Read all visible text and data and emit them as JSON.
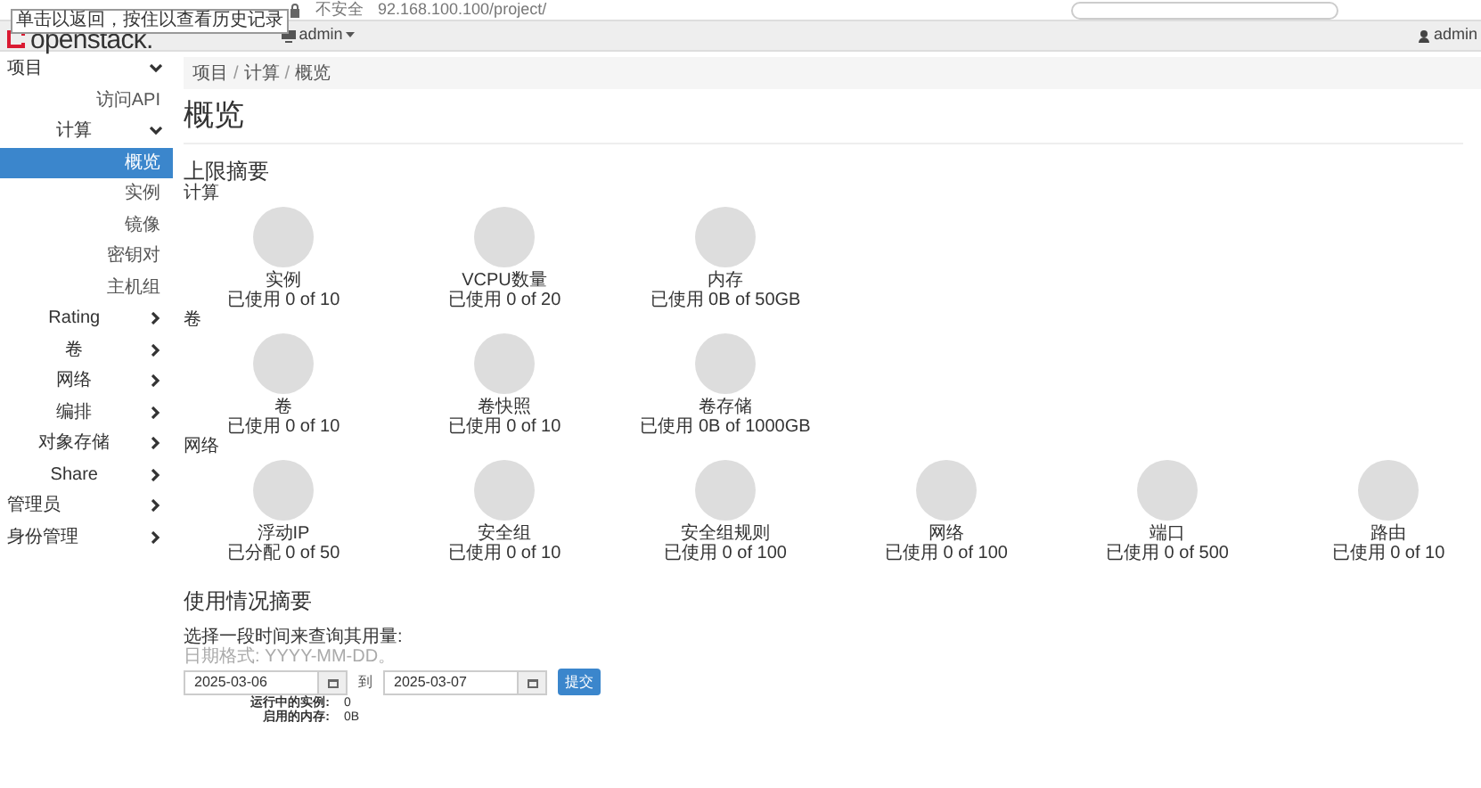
{
  "browser": {
    "security": "不安全",
    "url": "92.168.100.100/project/",
    "tooltip": "单击以返回，按住以查看历史记录"
  },
  "header": {
    "logo": "openstack.",
    "project_menu": "admin",
    "user": "admin"
  },
  "sidebar": {
    "items": [
      {
        "label": "项目",
        "kind": "group",
        "expanded": true,
        "children": [
          {
            "label": "访问API",
            "kind": "link",
            "selected": false
          },
          {
            "label": "计算",
            "kind": "group",
            "expanded": true,
            "children": [
              {
                "label": "概览",
                "kind": "link",
                "selected": true
              },
              {
                "label": "实例",
                "kind": "link",
                "selected": false
              },
              {
                "label": "镜像",
                "kind": "link",
                "selected": false
              },
              {
                "label": "密钥对",
                "kind": "link",
                "selected": false
              },
              {
                "label": "主机组",
                "kind": "link",
                "selected": false
              }
            ]
          },
          {
            "label": "Rating",
            "kind": "group",
            "expanded": false
          },
          {
            "label": "卷",
            "kind": "group",
            "expanded": false
          },
          {
            "label": "网络",
            "kind": "group",
            "expanded": false
          },
          {
            "label": "编排",
            "kind": "group",
            "expanded": false
          },
          {
            "label": "对象存储",
            "kind": "group",
            "expanded": false
          },
          {
            "label": "Share",
            "kind": "group",
            "expanded": false
          }
        ]
      },
      {
        "label": "管理员",
        "kind": "group",
        "expanded": false
      },
      {
        "label": "身份管理",
        "kind": "group",
        "expanded": false
      }
    ]
  },
  "breadcrumb": {
    "items": [
      "项目",
      "计算",
      "概览"
    ],
    "separator": "/"
  },
  "title": "概览",
  "limits": {
    "heading": "上限摘要",
    "groups": [
      {
        "title": "计算",
        "items": [
          {
            "label": "实例",
            "usage": "已使用 0 of 10"
          },
          {
            "label": "VCPU数量",
            "usage": "已使用 0 of 20"
          },
          {
            "label": "内存",
            "usage": "已使用 0B of 50GB"
          }
        ]
      },
      {
        "title": "卷",
        "items": [
          {
            "label": "卷",
            "usage": "已使用 0 of 10"
          },
          {
            "label": "卷快照",
            "usage": "已使用 0 of 10"
          },
          {
            "label": "卷存储",
            "usage": "已使用 0B of 1000GB"
          }
        ]
      },
      {
        "title": "网络",
        "items": [
          {
            "label": "浮动IP",
            "usage": "已分配 0 of 50"
          },
          {
            "label": "安全组",
            "usage": "已使用 0 of 10"
          },
          {
            "label": "安全组规则",
            "usage": "已使用 0 of 100"
          },
          {
            "label": "网络",
            "usage": "已使用 0 of 100"
          },
          {
            "label": "端口",
            "usage": "已使用 0 of 500"
          },
          {
            "label": "路由",
            "usage": "已使用 0 of 10"
          }
        ]
      }
    ]
  },
  "usage": {
    "heading": "使用情况摘要",
    "prompt": "选择一段时间来查询其用量:",
    "hint": "日期格式: YYYY-MM-DD。",
    "start_date": "2025-03-06",
    "to": "到",
    "end_date": "2025-03-07",
    "submit": "提交",
    "stats": [
      {
        "label": "运行中的实例:",
        "value": "0"
      },
      {
        "label": "启用的内存:",
        "value": "0B"
      }
    ]
  }
}
